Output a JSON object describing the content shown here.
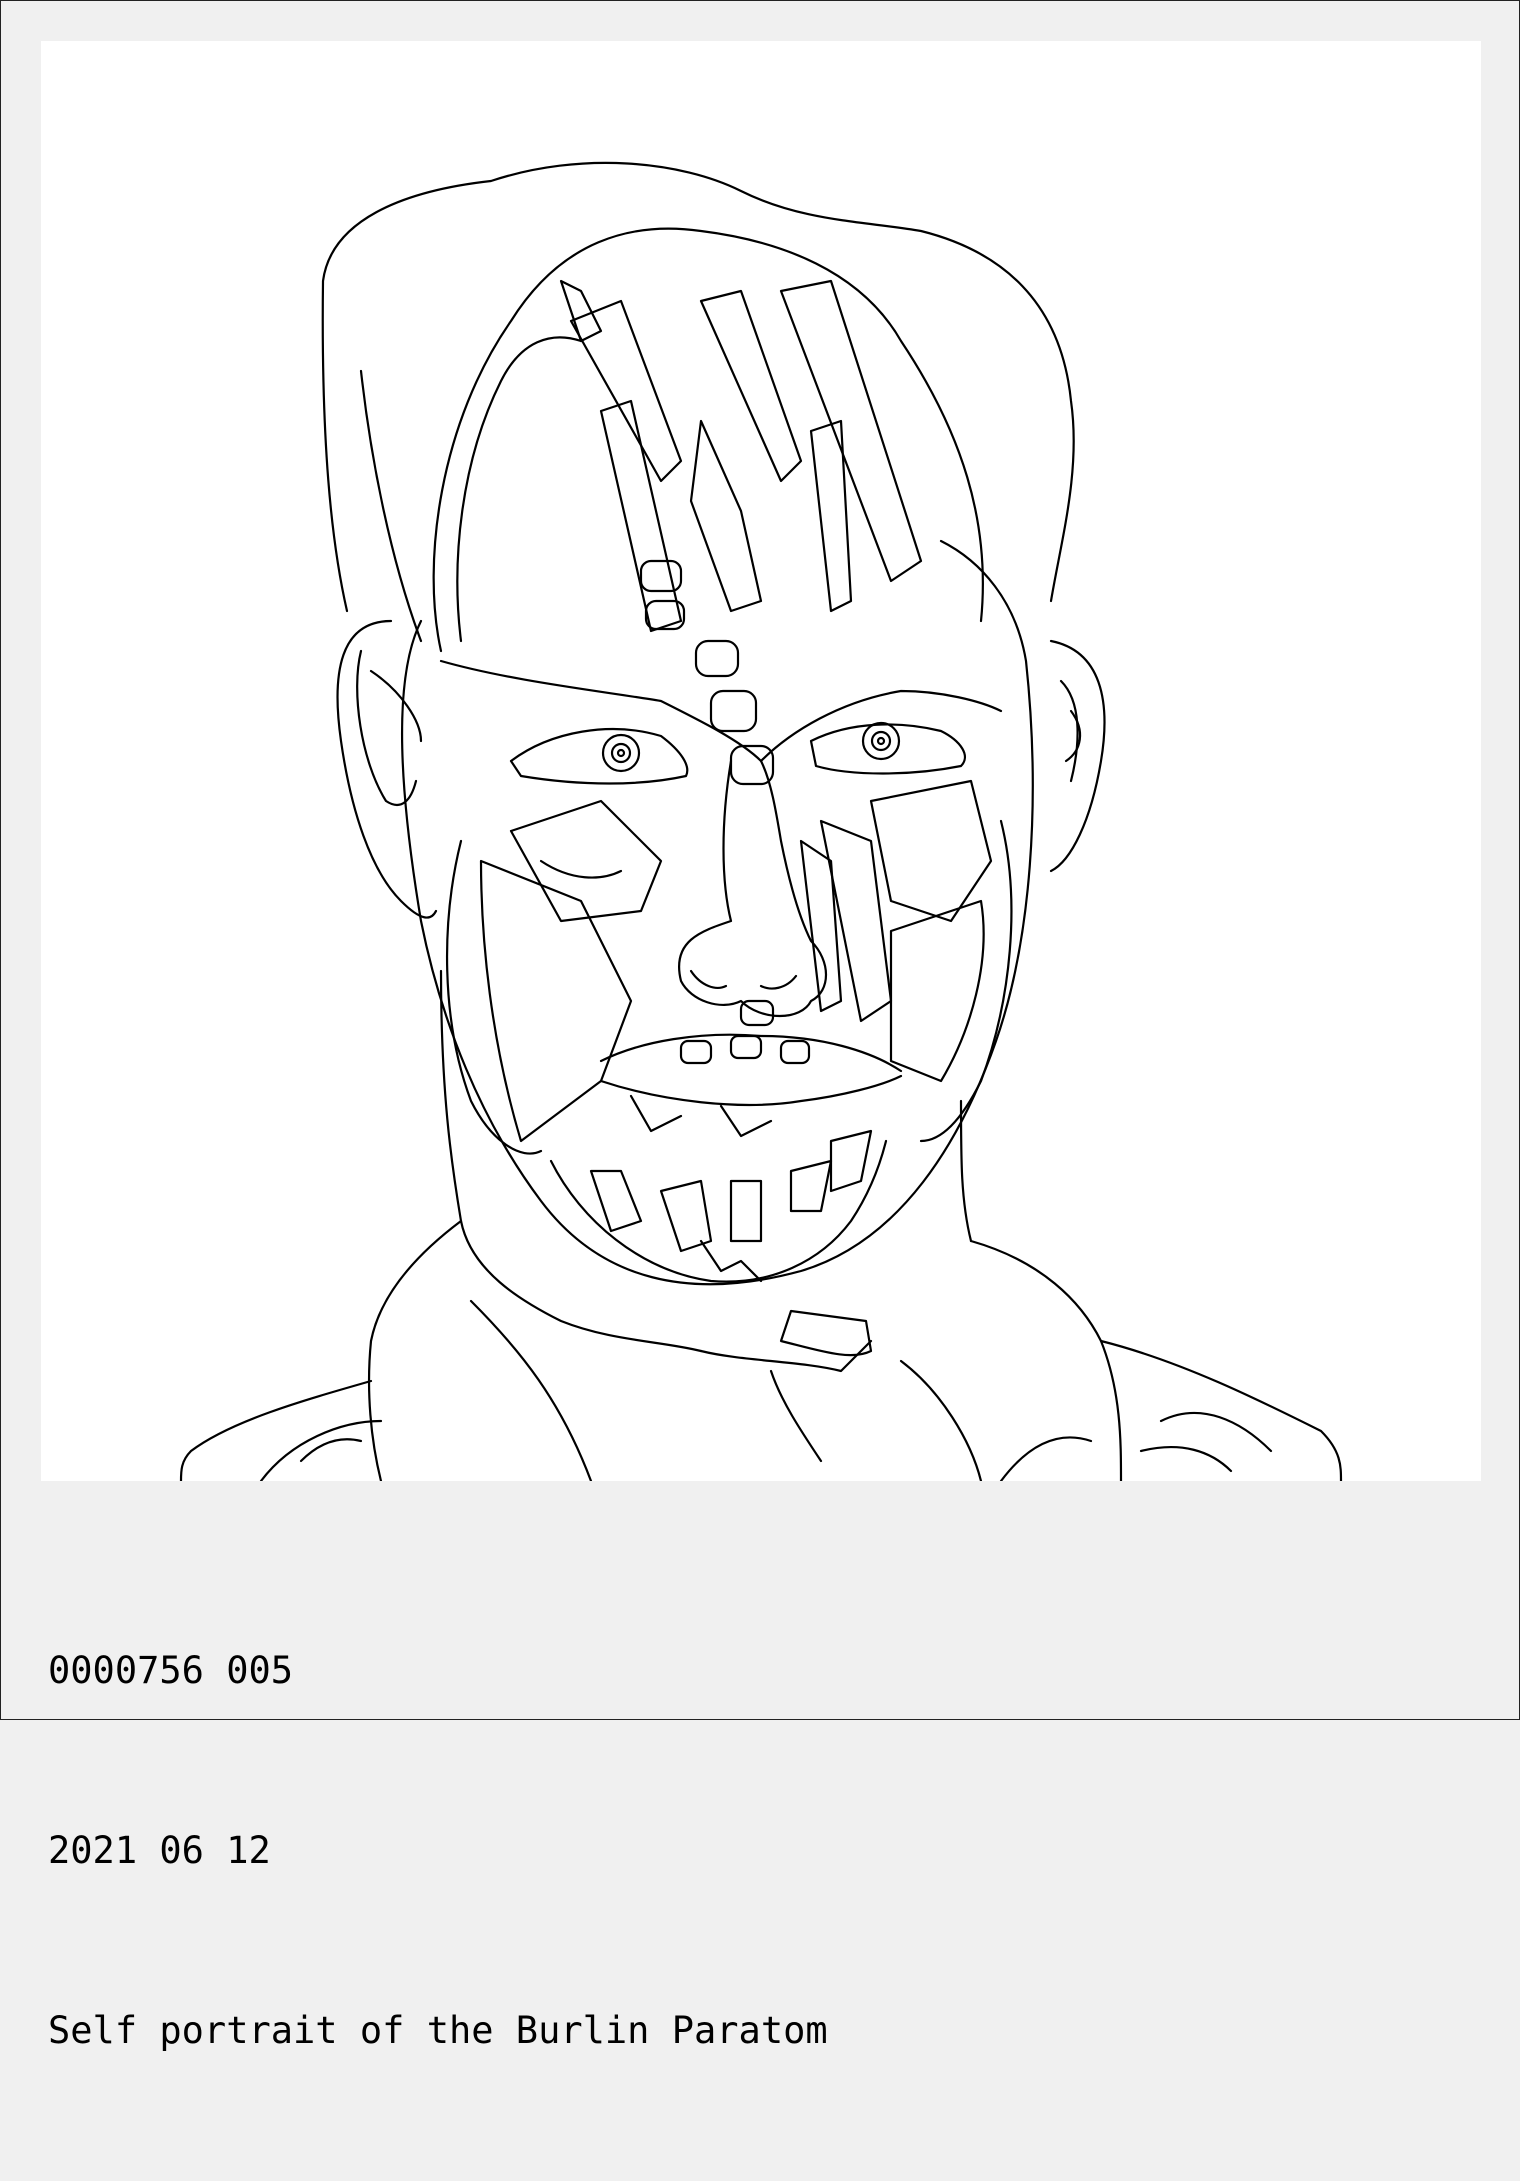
{
  "card": {
    "catalog_number": "0000756 005",
    "date": "2021 06 12",
    "title": "Self portrait of the Burlin Paratom"
  },
  "colors": {
    "background": "#f0f0f0",
    "artwork_background": "#ffffff",
    "line": "#000000"
  }
}
